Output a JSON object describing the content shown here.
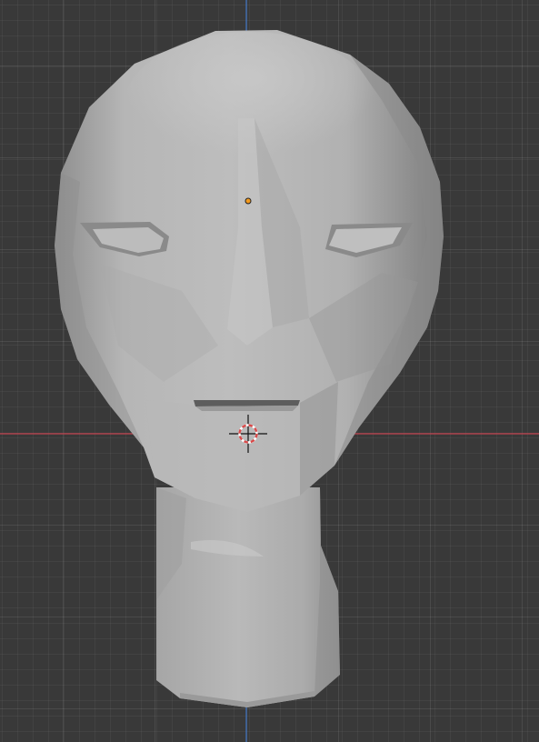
{
  "viewport": {
    "view": "front-orthographic",
    "background_color": "#393939",
    "grid_color": "#4a4a4a",
    "x_axis_color": "#c0414d",
    "z_axis_color": "#3f74c4"
  },
  "object": {
    "type": "mesh",
    "shape": "stylized head with neck",
    "shading": "solid",
    "surface_color": "#b4b4b4",
    "origin_color": "#f39a1e"
  },
  "cursor": {
    "icon": "3d-cursor-icon",
    "colors": [
      "#d84a4a",
      "#ffffff"
    ]
  }
}
